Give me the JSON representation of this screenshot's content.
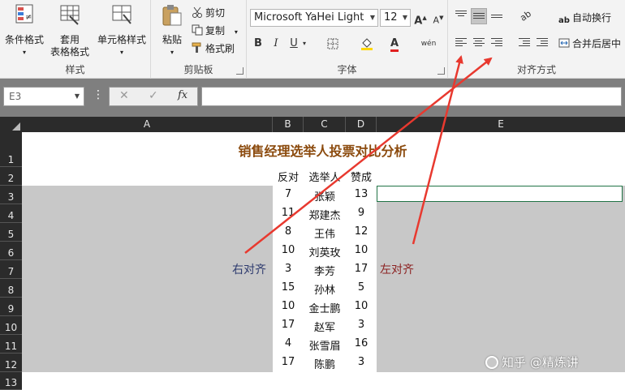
{
  "ribbon": {
    "styles": {
      "label": "样式",
      "conditional_format": "条件格式",
      "table_format": "套用\n表格格式",
      "cell_styles": "单元格样式"
    },
    "clipboard": {
      "label": "剪贴板",
      "paste": "粘贴",
      "cut": "剪切",
      "copy": "复制",
      "format_painter": "格式刷"
    },
    "font": {
      "label": "字体",
      "font_name": "Microsoft YaHei Light",
      "font_size": "12",
      "bold": "B",
      "italic": "I",
      "underline": "U",
      "grow": "A",
      "shrink": "A",
      "phonetic": "wén"
    },
    "alignment": {
      "label": "对齐方式",
      "wrap_text": "自动换行",
      "merge_center": "合并后居中"
    }
  },
  "formula_bar": {
    "name_box": "E3",
    "fx": "fx",
    "cancel": "✕",
    "enter": "✓",
    "formula": ""
  },
  "sheet": {
    "columns": [
      "A",
      "B",
      "C",
      "D",
      "E"
    ],
    "rows": [
      "1",
      "2",
      "3",
      "4",
      "5",
      "6",
      "7",
      "8",
      "9",
      "10",
      "11",
      "12",
      "13"
    ],
    "title": "销售经理选举人投票对比分析",
    "headers": {
      "b": "反对",
      "c": "选举人",
      "d": "赞成"
    },
    "data": [
      {
        "against": "7",
        "name": "张颖",
        "for": "13"
      },
      {
        "against": "11",
        "name": "郑建杰",
        "for": "9"
      },
      {
        "against": "8",
        "name": "王伟",
        "for": "12"
      },
      {
        "against": "10",
        "name": "刘英玫",
        "for": "10"
      },
      {
        "against": "3",
        "name": "李芳",
        "for": "17"
      },
      {
        "against": "15",
        "name": "孙林",
        "for": "5"
      },
      {
        "against": "10",
        "name": "金士鹏",
        "for": "10"
      },
      {
        "against": "17",
        "name": "赵军",
        "for": "3"
      },
      {
        "against": "4",
        "name": "张雪眉",
        "for": "16"
      },
      {
        "against": "17",
        "name": "陈鹏",
        "for": "3"
      }
    ],
    "annotation_right": "右对齐",
    "annotation_left": "左对齐"
  },
  "watermark": "知乎 @精炼讲"
}
